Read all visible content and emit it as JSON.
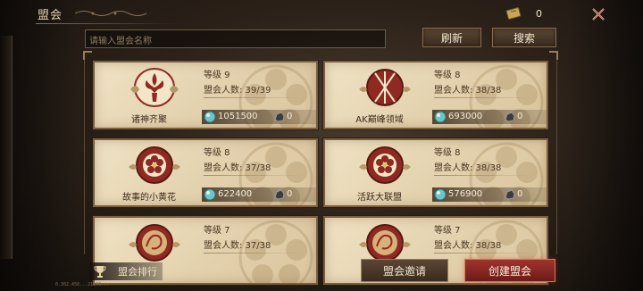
{
  "header": {
    "title": "盟会"
  },
  "currency": {
    "value": "0",
    "icon": "ticket-icon"
  },
  "search": {
    "placeholder": "请输入盟会名称"
  },
  "toolbar": {
    "refresh_label": "刷新",
    "search_label": "搜索"
  },
  "guilds": [
    {
      "name": "诸神齐聚",
      "level": "等级 9",
      "members": "盟会人数: 39/39",
      "gems": "1051500",
      "iron": "0",
      "emblem": "fleur-de-lis-icon"
    },
    {
      "name": "AK巅峰领域",
      "level": "等级 8",
      "members": "盟会人数: 38/38",
      "gems": "693000",
      "iron": "0",
      "emblem": "crossed-spears-icon"
    },
    {
      "name": "故事的小黄花",
      "level": "等级 8",
      "members": "盟会人数: 37/38",
      "gems": "622400",
      "iron": "0",
      "emblem": "flower-icon"
    },
    {
      "name": "活跃大联盟",
      "level": "等级 8",
      "members": "盟会人数: 38/38",
      "gems": "576900",
      "iron": "0",
      "emblem": "flower-icon"
    },
    {
      "name": "",
      "level": "等级 7",
      "members": "盟会人数: 37/38",
      "gems": "",
      "iron": "",
      "emblem": "dragon-icon"
    },
    {
      "name": "",
      "level": "等级 7",
      "members": "盟会人数: 38/38",
      "gems": "",
      "iron": "",
      "emblem": "dragon-icon"
    }
  ],
  "bottom": {
    "rank_label": "盟会排行",
    "invite_label": "盟会邀请",
    "create_label": "创建盟会"
  },
  "version": "0.302.450...21100...",
  "colors": {
    "accent_red": "#a0342c",
    "card_bg": "#e9dab8",
    "emblem_red": "#8e2a22",
    "gem_cyan": "#6fc4c8"
  }
}
